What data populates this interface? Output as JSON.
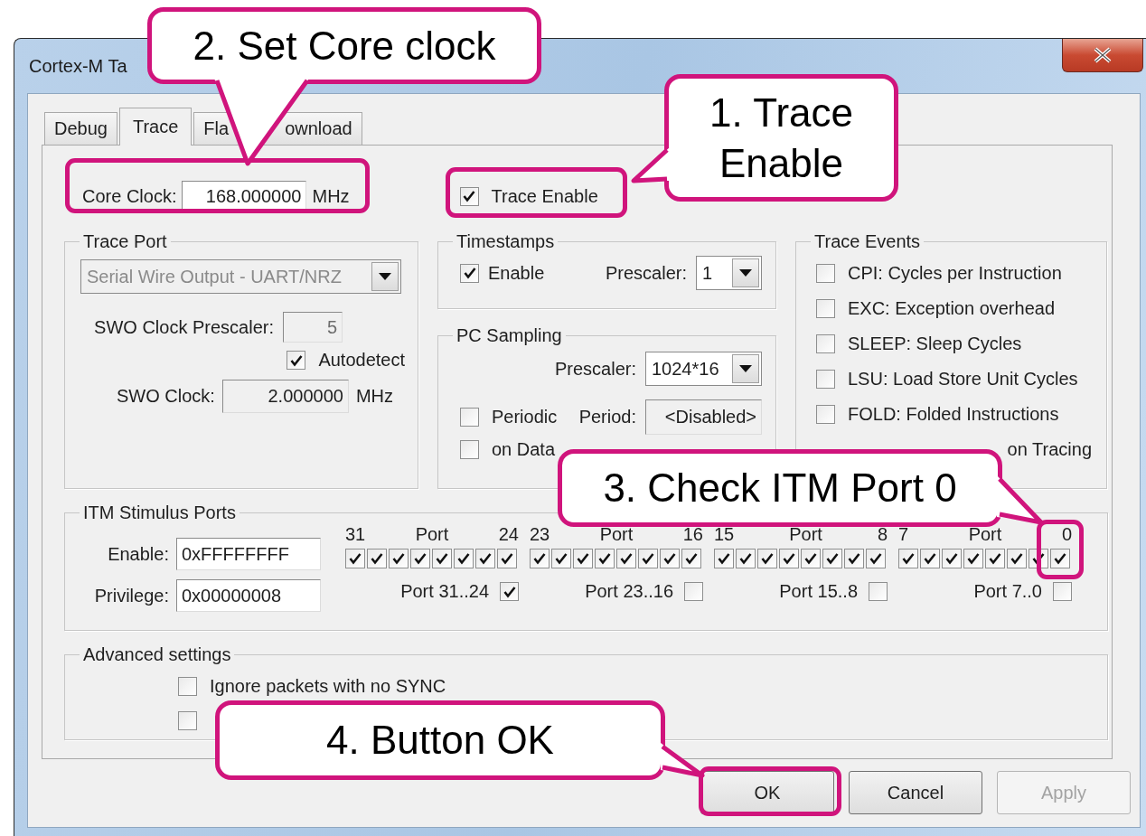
{
  "window": {
    "title": "Cortex-M Ta"
  },
  "tabs": [
    {
      "label": "Debug",
      "selected": false
    },
    {
      "label": "Trace",
      "selected": true
    },
    {
      "label": "Fla",
      "label_end": "ownload",
      "selected": false
    }
  ],
  "core_clock": {
    "label": "Core Clock:",
    "value": "168.000000",
    "unit": "MHz"
  },
  "trace_enable": {
    "label": "Trace Enable",
    "checked": true
  },
  "trace_port": {
    "title": "Trace Port",
    "mode": {
      "value": "Serial Wire Output - UART/NRZ",
      "disabled": true
    },
    "swo_prescaler": {
      "label": "SWO Clock Prescaler:",
      "value": "5",
      "disabled": true
    },
    "autodetect": {
      "label": "Autodetect",
      "checked": true
    },
    "swo_clock": {
      "label": "SWO Clock:",
      "value": "2.000000",
      "unit": "MHz",
      "disabled": true
    }
  },
  "timestamps": {
    "title": "Timestamps",
    "enable": {
      "label": "Enable",
      "checked": true
    },
    "prescaler": {
      "label": "Prescaler:",
      "value": "1"
    }
  },
  "pc_sampling": {
    "title": "PC Sampling",
    "prescaler": {
      "label": "Prescaler:",
      "value": "1024*16"
    },
    "periodic": {
      "label": "Periodic",
      "checked": false
    },
    "period": {
      "label": "Period:",
      "value": "<Disabled>"
    },
    "on_data": {
      "label": "on Data",
      "checked": false
    }
  },
  "trace_events": {
    "title": "Trace Events",
    "items": [
      {
        "kind": "checkbox",
        "label": "CPI: Cycles per Instruction",
        "checked": false
      },
      {
        "kind": "checkbox",
        "label": "EXC: Exception overhead",
        "checked": false
      },
      {
        "kind": "checkbox",
        "label": "SLEEP: Sleep Cycles",
        "checked": false
      },
      {
        "kind": "checkbox",
        "label": "LSU: Load Store Unit Cycles",
        "checked": false
      },
      {
        "kind": "checkbox",
        "label": "FOLD: Folded Instructions",
        "checked": false
      },
      {
        "kind": "covered",
        "label": "on Tracing"
      }
    ]
  },
  "itm": {
    "title": "ITM Stimulus Ports",
    "enable": {
      "label": "Enable:",
      "value": "0xFFFFFFFF"
    },
    "privilege": {
      "label": "Privilege:",
      "value": "0x00000008"
    },
    "ports": [
      {
        "high": "31",
        "label": "Port",
        "low": "24",
        "bits": [
          {
            "checked": true
          },
          {
            "checked": true
          },
          {
            "checked": true
          },
          {
            "checked": true
          },
          {
            "checked": true
          },
          {
            "checked": true
          },
          {
            "checked": true
          },
          {
            "checked": true
          }
        ],
        "privilege_label": "Port 31..24",
        "privilege": true
      },
      {
        "high": "23",
        "label": "Port",
        "low": "16",
        "bits": [
          {
            "checked": true
          },
          {
            "checked": true
          },
          {
            "checked": true
          },
          {
            "checked": true
          },
          {
            "checked": true
          },
          {
            "checked": true
          },
          {
            "checked": true
          },
          {
            "checked": true
          }
        ],
        "privilege_label": "Port 23..16",
        "privilege": false
      },
      {
        "high": "15",
        "label": "Port",
        "low": "8",
        "bits": [
          {
            "checked": true
          },
          {
            "checked": true
          },
          {
            "checked": true
          },
          {
            "checked": true
          },
          {
            "checked": true
          },
          {
            "checked": true
          },
          {
            "checked": true
          },
          {
            "checked": true
          }
        ],
        "privilege_label": "Port 15..8",
        "privilege": false
      },
      {
        "high": "7",
        "label": "Port",
        "low": "0",
        "bits": [
          {
            "checked": true
          },
          {
            "checked": true
          },
          {
            "checked": true
          },
          {
            "checked": true
          },
          {
            "checked": true
          },
          {
            "checked": true
          },
          {
            "checked": true
          },
          {
            "checked": true
          }
        ],
        "privilege_label": "Port 7..0",
        "privilege": false
      }
    ]
  },
  "advanced": {
    "title": "Advanced settings",
    "options": [
      {
        "label": "Ignore packets with no SYNC",
        "checked": false
      },
      {
        "checked": false
      }
    ]
  },
  "buttons": [
    {
      "label": "OK",
      "disabled": false
    },
    {
      "label": "Cancel",
      "disabled": false
    },
    {
      "label": "Apply",
      "disabled": true
    }
  ],
  "callouts": [
    {
      "text": "2. Set Core clock"
    },
    {
      "text": "1. Trace Enable"
    },
    {
      "text": "3. Check ITM Port 0"
    },
    {
      "text": "4. Button OK"
    }
  ]
}
